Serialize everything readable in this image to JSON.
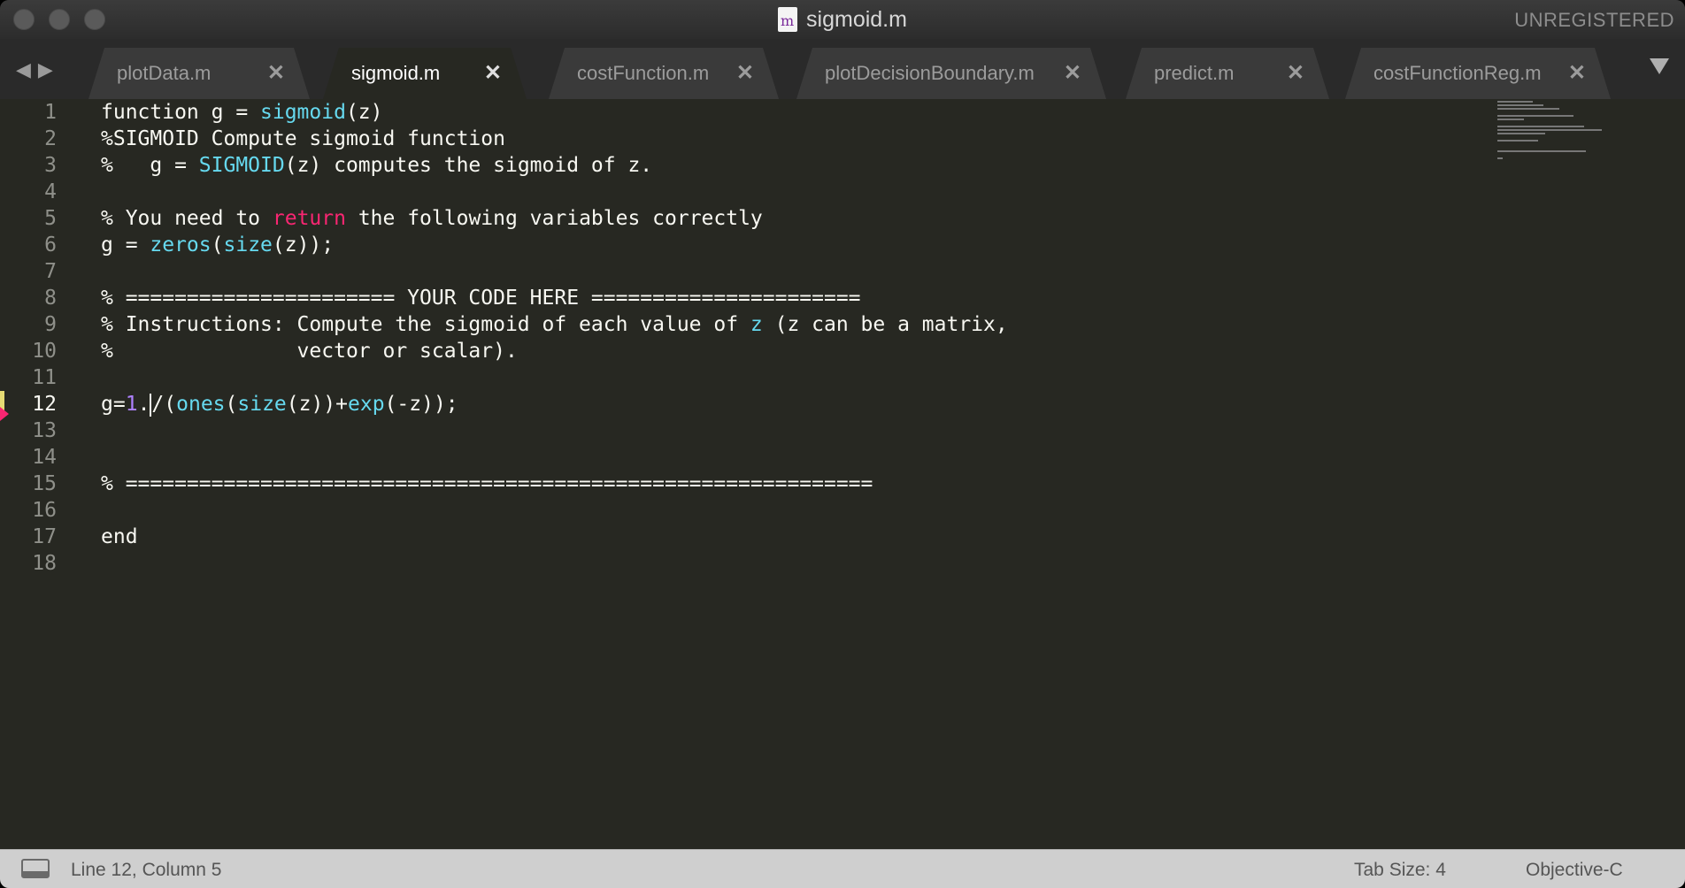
{
  "window": {
    "title": "sigmoid.m",
    "unregistered": "UNREGISTERED"
  },
  "tabs": [
    {
      "label": "plotData.m",
      "active": false
    },
    {
      "label": "sigmoid.m",
      "active": true
    },
    {
      "label": "costFunction.m",
      "active": false
    },
    {
      "label": "plotDecisionBoundary.m",
      "active": false
    },
    {
      "label": "predict.m",
      "active": false
    },
    {
      "label": "costFunctionReg.m",
      "active": false
    }
  ],
  "editor": {
    "current_line": 12,
    "line_numbers": [
      "1",
      "2",
      "3",
      "4",
      "5",
      "6",
      "7",
      "8",
      "9",
      "10",
      "11",
      "12",
      "13",
      "14",
      "15",
      "16",
      "17",
      "18"
    ],
    "lines": [
      "function g = sigmoid(z)",
      "%SIGMOID Compute sigmoid function",
      "%   g = SIGMOID(z) computes the sigmoid of z.",
      "",
      "% You need to return the following variables correctly",
      "g = zeros(size(z));",
      "",
      "% ====================== YOUR CODE HERE ======================",
      "% Instructions: Compute the sigmoid of each value of z (z can be a matrix,",
      "%               vector or scalar).",
      "",
      "g=1./(ones(size(z))+exp(-z));",
      "",
      "",
      "% =============================================================",
      "",
      "end",
      ""
    ]
  },
  "status": {
    "position": "Line 12, Column 5",
    "tab_size": "Tab Size: 4",
    "syntax": "Objective-C"
  },
  "icons": {
    "traffic_lights": "window-control-icons",
    "file": "matlab-file-icon",
    "nav": "tab-nav-arrows-icon",
    "tab_menu": "dropdown-triangle-icon",
    "panel": "panel-toggle-icon"
  },
  "colors": {
    "background": "#272822",
    "foreground": "#f8f8f2",
    "function": "#66d9ef",
    "keyword": "#f92672",
    "number": "#ae81ff",
    "status_bar": "#cfcfcf"
  }
}
